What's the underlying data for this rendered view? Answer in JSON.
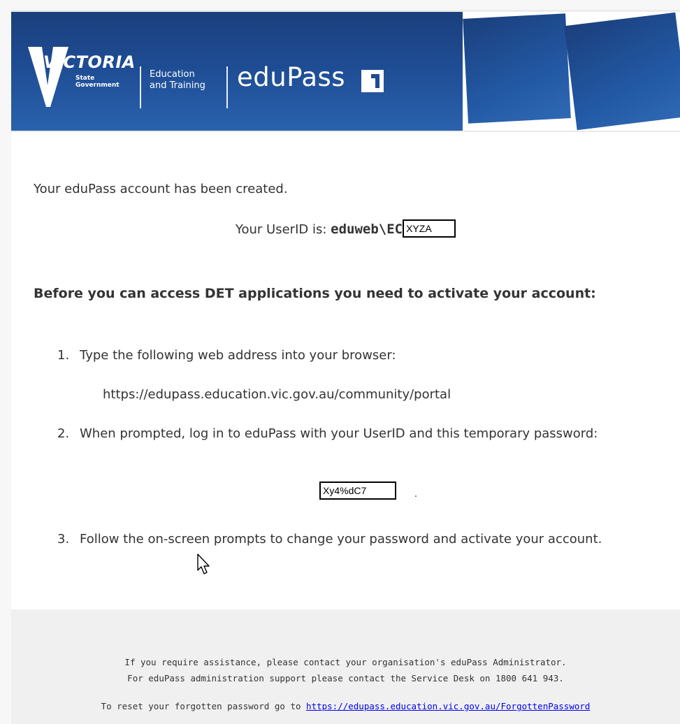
{
  "header": {
    "logo_word": "VICTORIA",
    "logo_sub_1": "State",
    "logo_sub_2": "Government",
    "dept_line_1": "Education",
    "dept_line_2": "and Training",
    "product_name": "eduPass",
    "brand_color": "#1e4c93"
  },
  "body": {
    "intro": "Your eduPass account has been created.",
    "userid_label": "Your UserID is: ",
    "userid_prefix": "eduweb\\EC",
    "userid_value": "XYZA",
    "heading": "Before you can access DET applications you need to activate your account:",
    "steps": [
      {
        "num": "1.",
        "text": "Type the following web address into your browser:"
      },
      {
        "num": "2.",
        "text": "When prompted, log in to eduPass with your UserID and this temporary password:"
      },
      {
        "num": "3.",
        "text": "Follow the on-screen prompts to change your password and activate your account."
      }
    ],
    "portal_url": "https://edupass.education.vic.gov.au/community/portal",
    "temp_password": "Xy4%dC7"
  },
  "footer": {
    "line_1": "If you require assistance, please contact your organisation's eduPass Administrator.",
    "line_2": "For eduPass administration support please contact the Service Desk on 1800 641 943.",
    "reset_text": "To reset your forgotten password go to ",
    "reset_link": "https://edupass.education.vic.gov.au/ForgottenPassword",
    "link_color": "#0000ee"
  }
}
